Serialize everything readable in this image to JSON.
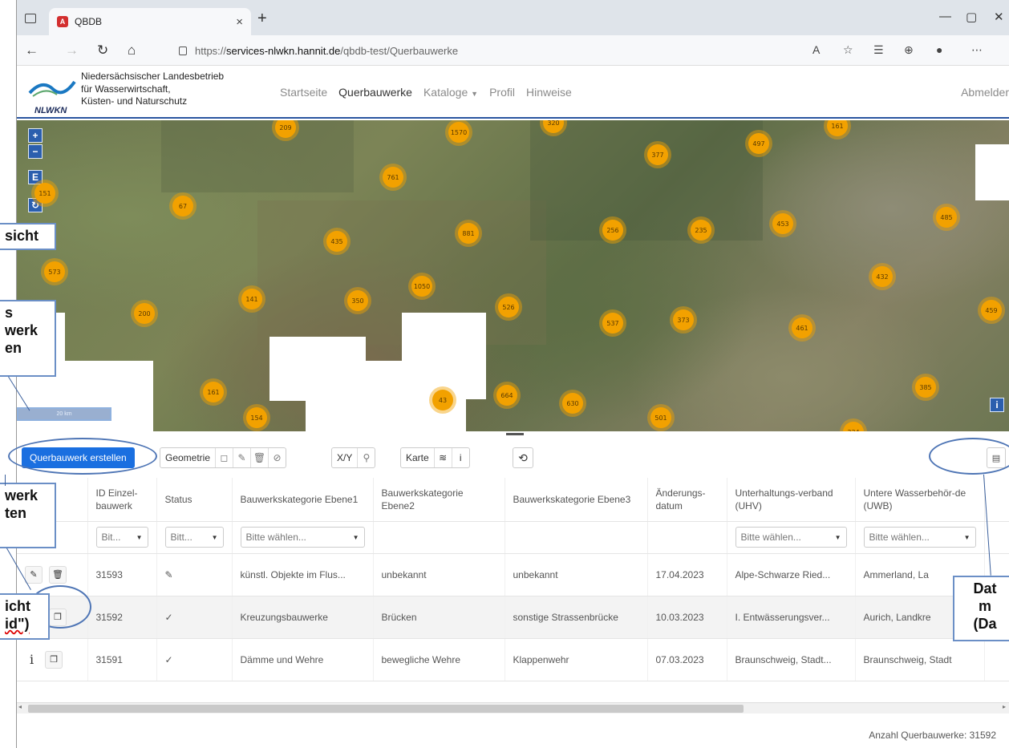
{
  "browser": {
    "tab_title": "QBDB",
    "tab_favicon": "A",
    "url_prefix": "https://",
    "url_host": "services-nlwkn.hannit.de",
    "url_path": "/qbdb-test/Querbauwerke"
  },
  "header": {
    "logo_text": "NLWKN",
    "org_lines": [
      "Niedersächsischer Landesbetrieb",
      "für Wasserwirtschaft,",
      "Küsten- und Naturschutz"
    ],
    "menu": [
      "Startseite",
      "Querbauwerke",
      "Kataloge",
      "Profil",
      "Hinweise"
    ],
    "logout": "Abmelder"
  },
  "map": {
    "zoom_in": "+",
    "zoom_out": "−",
    "extent_btn": "E",
    "scale_label": "20 km",
    "clusters": [
      "209",
      "1570",
      "320",
      "161",
      "377",
      "497",
      "761",
      "151",
      "67",
      "435",
      "881",
      "256",
      "235",
      "453",
      "485",
      "573",
      "1050",
      "141",
      "350",
      "526",
      "432",
      "200",
      "537",
      "373",
      "461",
      "459",
      "161",
      "43",
      "664",
      "630",
      "385",
      "154",
      "501",
      "334"
    ]
  },
  "toolbar": {
    "create_label": "Querbauwerk erstellen",
    "geometry_label": "Geometrie",
    "xy_label": "X/Y",
    "map_label": "Karte",
    "info_label": "i"
  },
  "table": {
    "headers": [
      "ID Einzel-bauwerk",
      "Status",
      "Bauwerkskategorie Ebene1",
      "Bauwerkskategorie Ebene2",
      "Bauwerkskategorie Ebene3",
      "Änderungs-datum",
      "Unterhaltungs-verband (UHV)",
      "Untere Wasserbehör-de (UWB)"
    ],
    "filters": {
      "id": "Bit...",
      "status": "Bitt...",
      "ebene1": "Bitte wählen...",
      "uhv": "Bitte wählen...",
      "uwb": "Bitte wählen..."
    },
    "rows": [
      {
        "id": "31593",
        "status": "✎",
        "e1": "künstl. Objekte im Flus...",
        "e2": "unbekannt",
        "e3": "unbekannt",
        "date": "17.04.2023",
        "uhv": "Alpe-Schwarze Ried...",
        "uwb": "Ammerland, La"
      },
      {
        "id": "31592",
        "status": "✓",
        "e1": "Kreuzungsbauwerke",
        "e2": "Brücken",
        "e3": "sonstige Strassenbrücke",
        "date": "10.03.2023",
        "uhv": "I. Entwässerungsver...",
        "uwb": "Aurich, Landkre"
      },
      {
        "id": "31591",
        "status": "✓",
        "e1": "Dämme und Wehre",
        "e2": "bewegliche Wehre",
        "e3": "Klappenwehr",
        "date": "07.03.2023",
        "uhv": "Braunschweig, Stadt...",
        "uwb": "Braunschweig, Stadt"
      }
    ],
    "count": "Anzahl Querbauwerke: 31592"
  },
  "callouts": {
    "c1": "sicht",
    "c2": [
      "s",
      "werk",
      "en"
    ],
    "c3": [
      "werk",
      "ten"
    ],
    "c4a": "icht",
    "c4b": "id\")",
    "c5": [
      "Dat",
      "m",
      "(Da"
    ]
  },
  "colors": {
    "primary": "#1a6fe0",
    "cluster": "#f2a100",
    "accent_border": "#2a55a0"
  }
}
